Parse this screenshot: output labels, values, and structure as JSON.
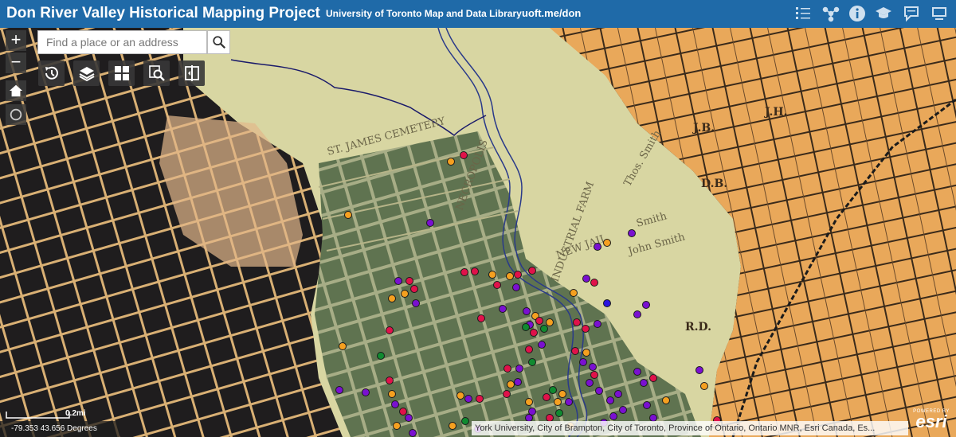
{
  "header": {
    "title": "Don River Valley Historical Mapping Project",
    "library_link": "University of Toronto Map and Data Library",
    "short_url": "uoft.me/don",
    "icons": [
      "legend-list-icon",
      "share-network-icon",
      "info-icon",
      "graduation-cap-icon",
      "comment-icon",
      "flag-map-icon"
    ]
  },
  "search": {
    "placeholder": "Find a place or an address"
  },
  "map_controls": {
    "zoom_in": "+",
    "zoom_out": "−",
    "tools": [
      "time-slider-icon",
      "layers-icon",
      "basemap-gallery-icon",
      "zoom-search-icon",
      "swipe-compare-icon"
    ],
    "nav": [
      "home-icon",
      "locate-icon"
    ]
  },
  "map_labels": [
    "ST. JAMES CEMETERY",
    "NECROPOLIS",
    "INDUSTRIAL FARM",
    "NEW JAIL",
    "Smith",
    "John Smith",
    "Thos. Smith",
    "J.B.",
    "D.B.",
    "J.H.",
    "R.D."
  ],
  "scale": {
    "label": "0.2mi"
  },
  "coordinates": "-79.353 43.656 Degrees",
  "attribution": "York University, City of Brampton, City of Toronto, Province of Ontario, Ontario MNR, Esri Canada, Es...",
  "esri": {
    "powered_by": "POWERED BY",
    "wordmark": "esri"
  },
  "colors": {
    "header_bg": "#1f6aa8",
    "point_orange": "#f5a020",
    "point_red": "#e0124a",
    "point_purple": "#7a10d0",
    "point_green": "#108a30",
    "point_blue": "#2a14e0"
  }
}
